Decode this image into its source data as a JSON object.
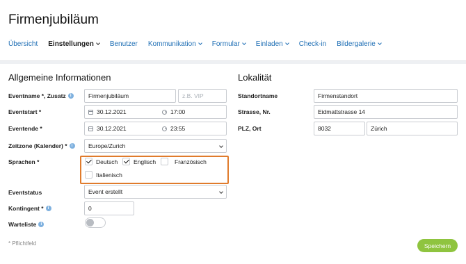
{
  "page": {
    "title": "Firmenjubiläum"
  },
  "nav": {
    "items": [
      {
        "label": "Übersicht",
        "has_dropdown": false,
        "active": false
      },
      {
        "label": "Einstellungen",
        "has_dropdown": true,
        "active": true
      },
      {
        "label": "Benutzer",
        "has_dropdown": false,
        "active": false
      },
      {
        "label": "Kommunikation",
        "has_dropdown": true,
        "active": false
      },
      {
        "label": "Formular",
        "has_dropdown": true,
        "active": false
      },
      {
        "label": "Einladen",
        "has_dropdown": true,
        "active": false
      },
      {
        "label": "Check-in",
        "has_dropdown": false,
        "active": false
      },
      {
        "label": "Bildergalerie",
        "has_dropdown": true,
        "active": false
      }
    ]
  },
  "general": {
    "title": "Allgemeine Informationen",
    "eventname": {
      "label": "Eventname *, Zusatz",
      "value": "Firmenjubiläum",
      "addition_placeholder": "z.B. VIP"
    },
    "eventstart": {
      "label": "Eventstart *",
      "date": "30.12.2021",
      "time": "17:00"
    },
    "eventende": {
      "label": "Eventende *",
      "date": "30.12.2021",
      "time": "23:55"
    },
    "timezone": {
      "label": "Zeitzone (Kalender) *",
      "value": "Europe/Zurich"
    },
    "languages": {
      "label": "Sprachen *",
      "options": [
        {
          "label": "Deutsch",
          "checked": true
        },
        {
          "label": "Englisch",
          "checked": true
        },
        {
          "label": "Französisch",
          "checked": false
        },
        {
          "label": "Italienisch",
          "checked": false
        }
      ]
    },
    "status": {
      "label": "Eventstatus",
      "value": "Event erstellt"
    },
    "quota": {
      "label": "Kontingent *",
      "value": "0"
    },
    "waitlist": {
      "label": "Warteliste",
      "enabled": false
    }
  },
  "location": {
    "title": "Lokalität",
    "name": {
      "label": "Standortname",
      "value": "Firmenstandort"
    },
    "street": {
      "label": "Strasse, Nr.",
      "value": "Eidmattstrasse 14"
    },
    "city": {
      "label": "PLZ, Ort",
      "zip": "8032",
      "city": "Zürich"
    }
  },
  "footer": {
    "required_note": "* Pflichtfeld",
    "save_label": "Speichern"
  },
  "colors": {
    "link": "#1f6fb5",
    "highlight": "#e07b2c",
    "save": "#8fc43f",
    "info": "#7fb1df"
  }
}
